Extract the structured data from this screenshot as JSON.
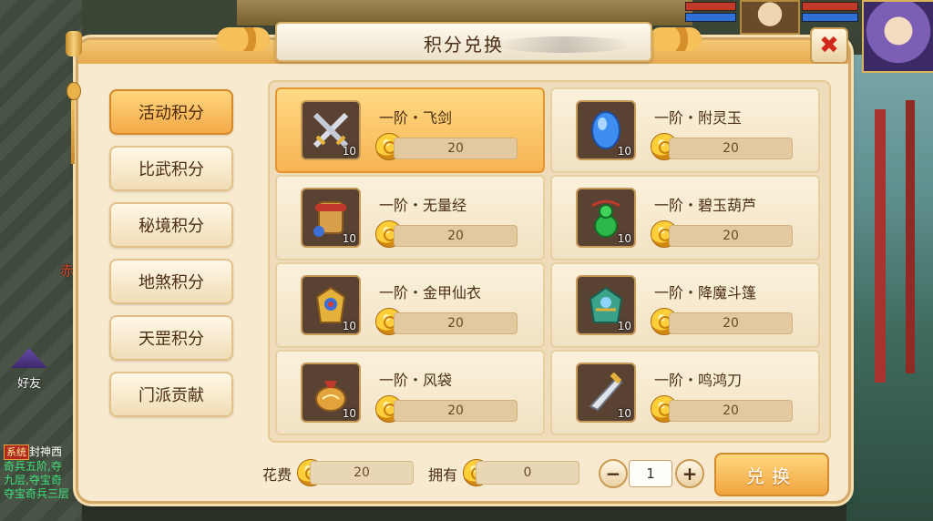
{
  "hud": {
    "friend_label": "好友",
    "red_label": "赤"
  },
  "chat": {
    "system_tag": "系统",
    "lines": [
      "封神西",
      "奇兵五阶,夺",
      "九层,夺宝奇",
      "夺宝奇兵三层"
    ]
  },
  "panel": {
    "title": "积分兑换"
  },
  "tabs": [
    {
      "label": "活动积分",
      "active": true
    },
    {
      "label": "比武积分",
      "active": false
    },
    {
      "label": "秘境积分",
      "active": false
    },
    {
      "label": "地煞积分",
      "active": false
    },
    {
      "label": "天罡积分",
      "active": false
    },
    {
      "label": "门派贡献",
      "active": false
    }
  ],
  "items": [
    {
      "name": "一阶・飞剑",
      "qty": "10",
      "price": "20",
      "icon": "crossed-swords-icon"
    },
    {
      "name": "一阶・附灵玉",
      "qty": "10",
      "price": "20",
      "icon": "blue-jade-icon"
    },
    {
      "name": "一阶・无量经",
      "qty": "10",
      "price": "20",
      "icon": "scroll-icon"
    },
    {
      "name": "一阶・碧玉葫芦",
      "qty": "10",
      "price": "20",
      "icon": "green-gourd-icon"
    },
    {
      "name": "一阶・金甲仙衣",
      "qty": "10",
      "price": "20",
      "icon": "gold-armor-icon"
    },
    {
      "name": "一阶・降魔斗篷",
      "qty": "10",
      "price": "20",
      "icon": "demon-cloak-icon"
    },
    {
      "name": "一阶・风袋",
      "qty": "10",
      "price": "20",
      "icon": "wind-bag-icon"
    },
    {
      "name": "一阶・鸣鸿刀",
      "qty": "10",
      "price": "20",
      "icon": "golden-blade-icon"
    }
  ],
  "footer": {
    "cost_label": "花费",
    "cost_value": "20",
    "own_label": "拥有",
    "own_value": "0",
    "quantity": "1",
    "minus": "−",
    "plus": "+",
    "exchange_label": "兑换"
  },
  "colors": {
    "accent": "#f3a948",
    "coin": "#ffcf3a",
    "close": "#d12a1c"
  }
}
